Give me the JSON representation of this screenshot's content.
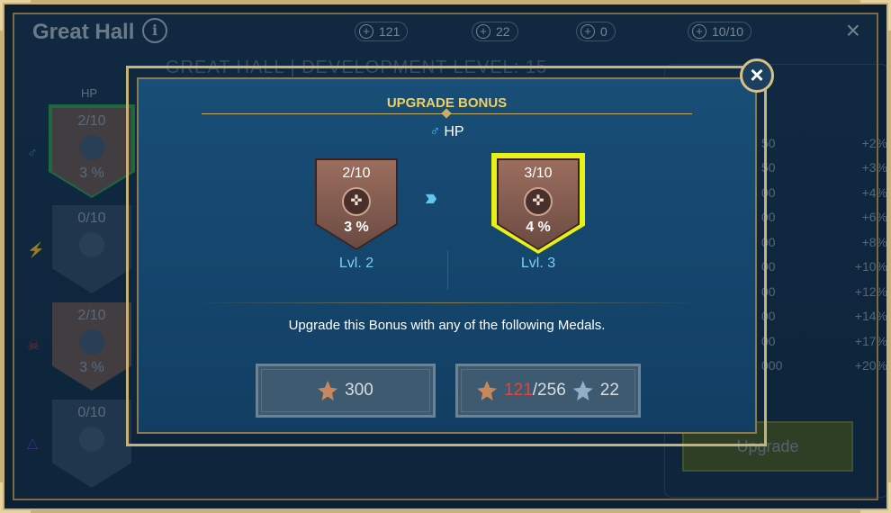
{
  "background": {
    "title": "Great Hall",
    "info_icon": "i",
    "subtitle": "GREAT HALL | DEVELOPMENT LEVEL: 15",
    "resources": [
      {
        "value": "121",
        "icon": "bronze-medal-icon"
      },
      {
        "value": "22",
        "icon": "silver-medal-icon"
      },
      {
        "value": "0",
        "icon": "gold-medal-icon"
      },
      {
        "value": "10/10",
        "icon": "egg-icon"
      }
    ],
    "column_header": "HP",
    "shields": [
      {
        "level": "2/10",
        "percent": "3 %"
      },
      {
        "level": "0/10",
        "percent": ""
      },
      {
        "level": "2/10",
        "percent": "3 %"
      },
      {
        "level": "0/10",
        "percent": ""
      }
    ],
    "bonus_list": [
      {
        "cost": "50",
        "bonus": "+2%"
      },
      {
        "cost": "50",
        "bonus": "+3%"
      },
      {
        "cost": "00",
        "bonus": "+4%"
      },
      {
        "cost": "00",
        "bonus": "+6%"
      },
      {
        "cost": "00",
        "bonus": "+8%"
      },
      {
        "cost": "00",
        "bonus": "+10%"
      },
      {
        "cost": "00",
        "bonus": "+12%"
      },
      {
        "cost": "00",
        "bonus": "+14%"
      },
      {
        "cost": "00",
        "bonus": "+17%"
      },
      {
        "cost": "000",
        "bonus": "+20%"
      }
    ],
    "upgrade_label": "Upgrade",
    "close_glyph": "×"
  },
  "dialog": {
    "header": "UPGRADE BONUS",
    "stat_symbol": "♂",
    "stat_label": "HP",
    "current": {
      "level": "2/10",
      "percent": "3 %",
      "lvl_label": "Lvl. 2"
    },
    "next": {
      "level": "3/10",
      "percent": "4 %",
      "lvl_label": "Lvl. 3"
    },
    "arrows_glyph": "›››",
    "message": "Upgrade this Bonus with any of the following Medals.",
    "option_one": {
      "amount": "300"
    },
    "option_two": {
      "have": "121",
      "need": "/256",
      "silver": "22"
    },
    "close_glyph": "×",
    "colors": {
      "header": "#f0cf63",
      "accent": "#7fd0f0",
      "highlight": "#e8f01a",
      "insufficient": "#e0463c"
    }
  }
}
